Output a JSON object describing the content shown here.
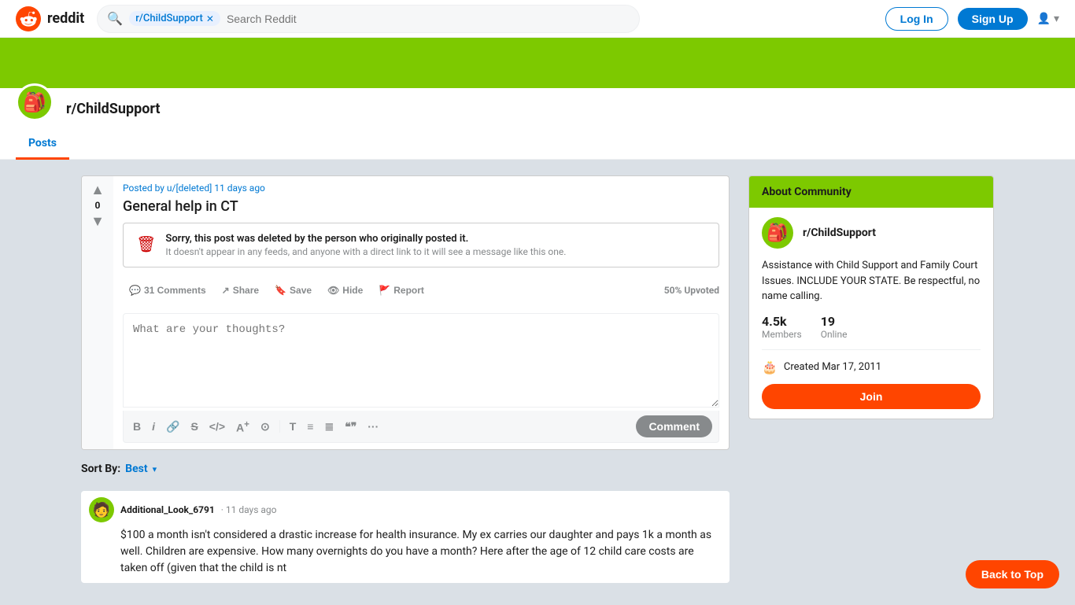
{
  "header": {
    "logo_text": "reddit",
    "search_tag": "r/ChildSupport",
    "search_placeholder": "Search Reddit",
    "login_label": "Log In",
    "signup_label": "Sign Up"
  },
  "banner": {
    "subreddit_name": "r/ChildSupport"
  },
  "nav": {
    "tab_label": "Posts"
  },
  "post": {
    "meta": "Posted by u/[deleted] 11 days ago",
    "title": "General help in CT",
    "vote_count": "0",
    "deleted_primary": "Sorry, this post was deleted by the person who originally posted it.",
    "deleted_secondary": "It doesn't appear in any feeds, and anyone with a direct link to it will see a message like this one.",
    "comments_label": "31 Comments",
    "share_label": "Share",
    "save_label": "Save",
    "hide_label": "Hide",
    "report_label": "Report",
    "upvote_pct": "50% Upvoted",
    "comment_placeholder": "What are your thoughts?",
    "comment_btn": "Comment"
  },
  "sort": {
    "label": "Sort By:",
    "value": "Best"
  },
  "comments": [
    {
      "author": "Additional_Look_6791",
      "time": "· 11 days ago",
      "text": "$100 a month isn't considered a drastic increase for health insurance. My ex carries our daughter and pays 1k a month as well. Children are expensive. How many overnights do you have a month? Here after the age of 12 child care costs are taken off (given that the child is nt"
    }
  ],
  "sidebar": {
    "header": "About Community",
    "subreddit_name": "r/ChildSupport",
    "description": "Assistance with Child Support and Family Court Issues. INCLUDE YOUR STATE. Be respectful, no name calling.",
    "members_value": "4.5k",
    "members_label": "Members",
    "online_value": "19",
    "online_label": "Online",
    "created_text": "Created Mar 17, 2011",
    "join_label": "Join"
  },
  "back_to_top": "Back to Top",
  "toolbar": {
    "bold": "B",
    "italic": "i",
    "link": "🔗",
    "strikethrough": "S",
    "code": "</>",
    "superscript": "A",
    "spoiler": "⚠",
    "heading": "T",
    "list_unordered": "≡",
    "list_ordered": "≡",
    "blockquote": "\"\"",
    "more": "···"
  }
}
